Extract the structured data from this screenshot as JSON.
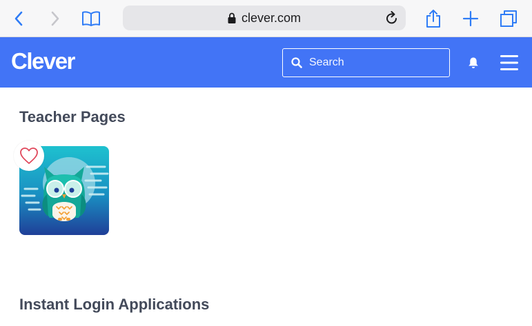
{
  "browser": {
    "url": "clever.com",
    "icons": [
      "back-icon",
      "forward-icon",
      "bookmarks-icon",
      "lock-icon",
      "reload-icon",
      "share-icon",
      "new-tab-icon",
      "tabs-icon"
    ]
  },
  "header": {
    "logo": "Clever",
    "search_placeholder": "Search",
    "icons": [
      "search-icon",
      "bell-icon",
      "hamburger-menu-icon"
    ]
  },
  "sections": {
    "teacher_pages": {
      "title": "Teacher Pages"
    },
    "instant_login": {
      "title": "Instant Login Applications"
    }
  },
  "colors": {
    "brand_blue": "#4274f6",
    "heading": "#434a5a",
    "safari_accent": "#2f7cf6",
    "heart": "#e0475b"
  }
}
